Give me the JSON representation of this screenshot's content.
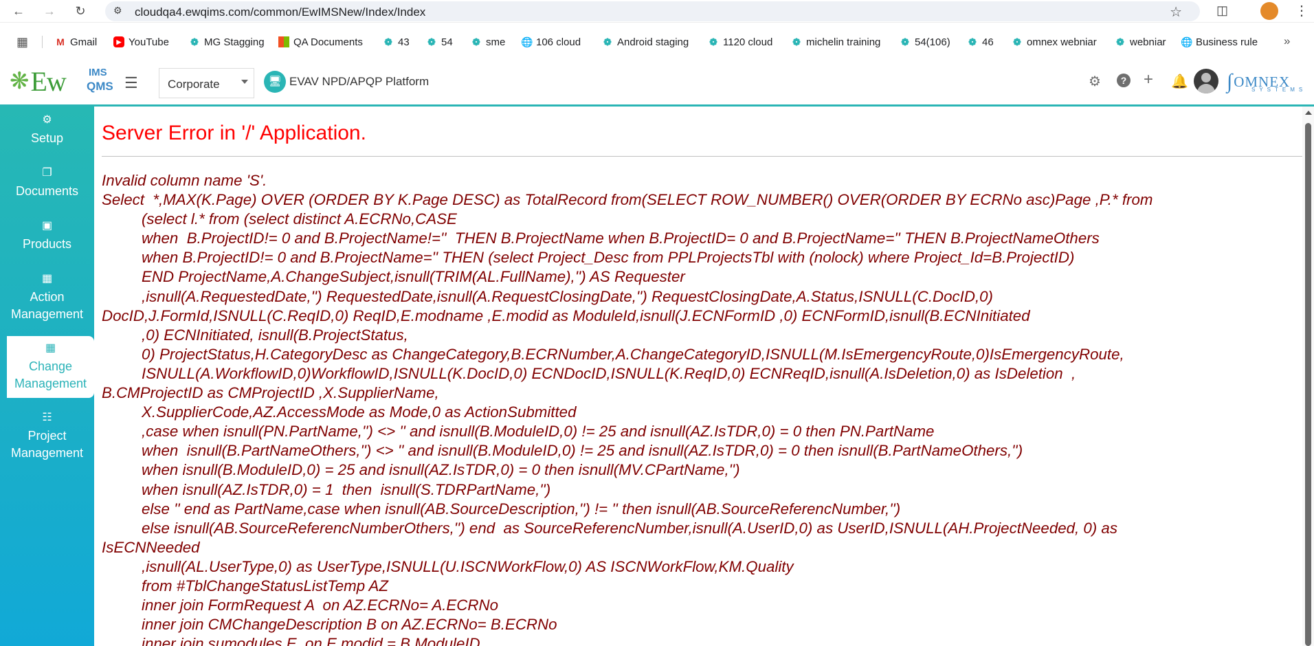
{
  "browser": {
    "url": "cloudqa4.ewqims.com/common/EwIMSNew/Index/Index",
    "bookmarks": [
      {
        "label": "Gmail",
        "icon": "gmail-icon"
      },
      {
        "label": "YouTube",
        "icon": "youtube-icon"
      },
      {
        "label": "MG Stagging",
        "icon": "ewqims-icon"
      },
      {
        "label": "QA Documents",
        "icon": "microsoft-icon"
      },
      {
        "label": "43",
        "icon": "ewqims-icon"
      },
      {
        "label": "54",
        "icon": "ewqims-icon"
      },
      {
        "label": "sme",
        "icon": "ewqims-icon"
      },
      {
        "label": "106 cloud",
        "icon": "globe-icon"
      },
      {
        "label": "Android staging",
        "icon": "ewqims-icon"
      },
      {
        "label": "1120 cloud",
        "icon": "ewqims-icon"
      },
      {
        "label": "michelin training",
        "icon": "ewqims-icon"
      },
      {
        "label": "54(106)",
        "icon": "ewqims-icon"
      },
      {
        "label": "46",
        "icon": "ewqims-icon"
      },
      {
        "label": "omnex webniar",
        "icon": "ewqims-icon"
      },
      {
        "label": "webniar",
        "icon": "ewqims-icon"
      },
      {
        "label": "Business rule",
        "icon": "globe-icon"
      }
    ]
  },
  "header": {
    "logo_main": "Ew",
    "logo_ims": "IMS",
    "logo_qms": "QMS",
    "site_select": "Corporate",
    "platform": "EVAV NPD/APQP Platform",
    "brand": "OMNEX",
    "brand_sub": "SYSTEMS"
  },
  "sidebar": {
    "items": [
      {
        "label": "Setup",
        "icon": "gears-icon"
      },
      {
        "label": "Documents",
        "icon": "documents-icon"
      },
      {
        "label": "Products",
        "icon": "products-icon"
      },
      {
        "label": "Action Management",
        "icon": "building-icon"
      },
      {
        "label": "Change Management",
        "icon": "building-icon"
      },
      {
        "label": "Project Management",
        "icon": "hierarchy-icon"
      }
    ],
    "active": "Change Management"
  },
  "error": {
    "title": "Server Error in '/' Application.",
    "lines": [
      {
        "text": "Invalid column name 'S'.",
        "indent": false
      },
      {
        "text": "Select  *,MAX(K.Page) OVER (ORDER BY K.Page DESC) as TotalRecord from(SELECT ROW_NUMBER() OVER(ORDER BY ECRNo asc)Page ,P.* from",
        "indent": false
      },
      {
        "text": "(select l.* from (select distinct A.ECRNo,CASE",
        "indent": true
      },
      {
        "text": "when  B.ProjectID!= 0 and B.ProjectName!=''  THEN B.ProjectName when B.ProjectID= 0 and B.ProjectName='' THEN B.ProjectNameOthers",
        "indent": true
      },
      {
        "text": "when B.ProjectID!= 0 and B.ProjectName='' THEN (select Project_Desc from PPLProjectsTbl with (nolock) where Project_Id=B.ProjectID)",
        "indent": true
      },
      {
        "text": "END ProjectName,A.ChangeSubject,isnull(TRIM(AL.FullName),'') AS Requester",
        "indent": true
      },
      {
        "text": ",isnull(A.RequestedDate,'') RequestedDate,isnull(A.RequestClosingDate,'') RequestClosingDate,A.Status,ISNULL(C.DocID,0)",
        "indent": true
      },
      {
        "text": "DocID,J.FormId,ISNULL(C.ReqID,0) ReqID,E.modname ,E.modid as ModuleId,isnull(J.ECNFormID ,0) ECNFormID,isnull(B.ECNInitiated",
        "indent": false
      },
      {
        "text": ",0) ECNInitiated, isnull(B.ProjectStatus,",
        "indent": true
      },
      {
        "text": "0) ProjectStatus,H.CategoryDesc as ChangeCategory,B.ECRNumber,A.ChangeCategoryID,ISNULL(M.IsEmergencyRoute,0)IsEmergencyRoute,",
        "indent": true
      },
      {
        "text": "ISNULL(A.WorkflowID,0)WorkflowID,ISNULL(K.DocID,0) ECNDocID,ISNULL(K.ReqID,0) ECNReqID,isnull(A.IsDeletion,0) as IsDeletion  ,",
        "indent": true
      },
      {
        "text": "B.CMProjectID as CMProjectID ,X.SupplierName,",
        "indent": false
      },
      {
        "text": "X.SupplierCode,AZ.AccessMode as Mode,0 as ActionSubmitted",
        "indent": true
      },
      {
        "text": ",case when isnull(PN.PartName,'') <> '' and isnull(B.ModuleID,0) != 25 and isnull(AZ.IsTDR,0) = 0 then PN.PartName",
        "indent": true
      },
      {
        "text": "when  isnull(B.PartNameOthers,'') <> '' and isnull(B.ModuleID,0) != 25 and isnull(AZ.IsTDR,0) = 0 then isnull(B.PartNameOthers,'')",
        "indent": true
      },
      {
        "text": "when isnull(B.ModuleID,0) = 25 and isnull(AZ.IsTDR,0) = 0 then isnull(MV.CPartName,'')",
        "indent": true
      },
      {
        "text": "when isnull(AZ.IsTDR,0) = 1  then  isnull(S.TDRPartName,'')",
        "indent": true
      },
      {
        "text": "else '' end as PartName,case when isnull(AB.SourceDescription,'') != '' then isnull(AB.SourceReferencNumber,'')",
        "indent": true
      },
      {
        "text": "else isnull(AB.SourceReferencNumberOthers,'') end  as SourceReferencNumber,isnull(A.UserID,0) as UserID,ISNULL(AH.ProjectNeeded, 0) as",
        "indent": true
      },
      {
        "text": "IsECNNeeded",
        "indent": false
      },
      {
        "text": ",isnull(AL.UserType,0) as UserType,ISNULL(U.ISCNWorkFlow,0) AS ISCNWorkFlow,KM.Quality",
        "indent": true
      },
      {
        "text": "from #TblChangeStatusListTemp AZ",
        "indent": true
      },
      {
        "text": "inner join FormRequest A  on AZ.ECRNo= A.ECRNo",
        "indent": true
      },
      {
        "text": "inner join CMChangeDescription B on AZ.ECRNo= B.ECRNo",
        "indent": true
      },
      {
        "text": "inner join sumodules E  on E.modid = B.ModuleID",
        "indent": true
      }
    ]
  },
  "colors": {
    "accent": "#2ab5b5",
    "error_title": "#ff0000",
    "error_text": "#800000"
  }
}
